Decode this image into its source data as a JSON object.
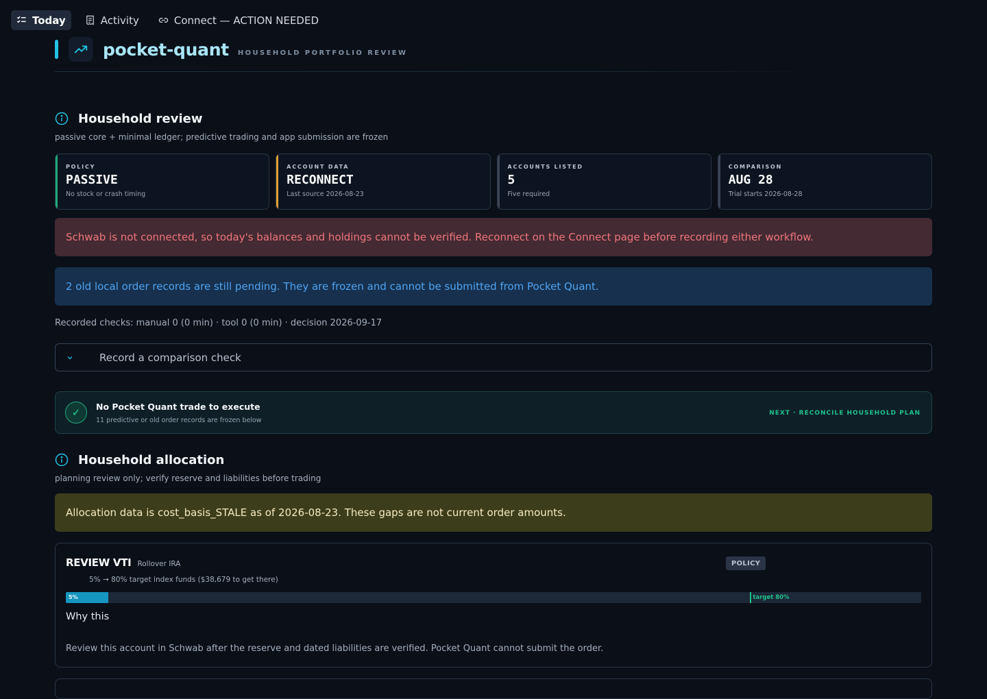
{
  "nav": {
    "tabs": [
      {
        "label": "Today",
        "icon": "checklist-icon",
        "active": true
      },
      {
        "label": "Activity",
        "icon": "receipt-icon",
        "active": false
      },
      {
        "label": "Connect — ACTION NEEDED",
        "icon": "link-icon",
        "active": false
      }
    ]
  },
  "brand": {
    "name": "pocket-quant",
    "subtitle": "HOUSEHOLD PORTFOLIO REVIEW",
    "logo_icon": "trending-up-icon",
    "accent": "#22c3e6"
  },
  "household_review": {
    "title": "Household review",
    "subtitle": "passive core + minimal ledger; predictive trading and app submission are frozen",
    "cards": [
      {
        "label": "POLICY",
        "value": "PASSIVE",
        "note": "No stock or crash timing",
        "accent": "#1ea97a"
      },
      {
        "label": "ACCOUNT DATA",
        "value": "RECONNECT",
        "note": "Last source 2026-08-23",
        "accent": "#e0a12e"
      },
      {
        "label": "ACCOUNTS LISTED",
        "value": "5",
        "note": "Five required",
        "accent": "#3a4658"
      },
      {
        "label": "COMPARISON",
        "value": "AUG 28",
        "note": "Trial starts 2026-08-28",
        "accent": "#3a4658"
      }
    ]
  },
  "alerts": {
    "error": "Schwab is not connected, so today's balances and holdings cannot be verified. Reconnect on the Connect page before recording either workflow.",
    "info": "2 old local order records are still pending. They are frozen and cannot be submitted from Pocket Quant."
  },
  "recorded_checks": "Recorded checks: manual 0 (0 min) · tool 0 (0 min) · decision 2026-09-17",
  "comparison_check": {
    "label": "Record a comparison check",
    "icon": "chevron-down-icon"
  },
  "next_action": {
    "title": "No Pocket Quant trade to execute",
    "subtitle": "11 predictive or old order records are frozen below",
    "link": "NEXT · RECONCILE HOUSEHOLD PLAN",
    "icon": "check-icon",
    "check_glyph": "✓"
  },
  "household_allocation": {
    "title": "Household allocation",
    "subtitle": "planning review only; verify reserve and liabilities before trading",
    "warning": "Allocation data is cost_basis_STALE as of 2026-08-23. These gaps are not current order amounts."
  },
  "review_item": {
    "title": "REVIEW VTI",
    "account": "Rollover IRA",
    "badge": "POLICY",
    "target_text": "5% → 80% target index funds ($38,679 to get there)",
    "current_pct": 5,
    "target_pct": 80,
    "current_label": "5%",
    "target_label": "target 80%",
    "why_title": "Why this",
    "body": "Review this account in Schwab after the reserve and dated liabilities are verified. Pocket Quant cannot submit the order."
  }
}
